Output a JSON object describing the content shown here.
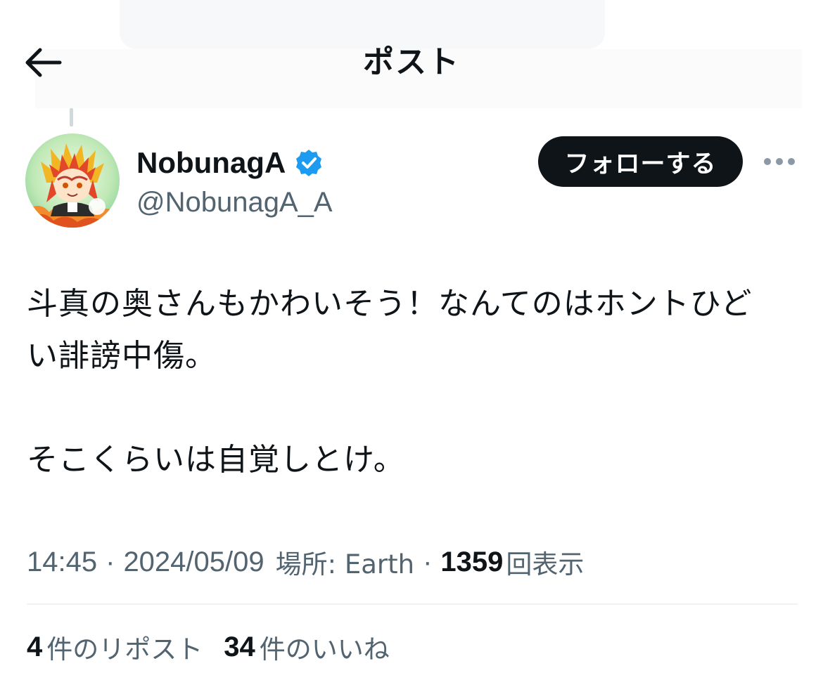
{
  "header": {
    "title": "ポスト",
    "back_icon": "arrow-left-icon"
  },
  "author": {
    "name": "NobunagA",
    "handle": "@NobunagA_A",
    "verified": true,
    "verified_color": "#1d9bf0",
    "avatar_icon": "anime-character-avatar"
  },
  "actions": {
    "follow_label": "フォローする",
    "more_icon": "more-horizontal-icon"
  },
  "tweet": {
    "text": "斗真の奥さんもかわいそう！なんてのはホントひど\nい誹謗中傷。\n\nそこくらいは自覚しとけ。"
  },
  "meta": {
    "time": "14:45",
    "separator": "·",
    "date": "2024/05/09",
    "location_label": "場所: Earth",
    "views_count": "1359",
    "views_label": "回表示"
  },
  "stats": {
    "reposts_count": "4",
    "reposts_label": "件のリポスト",
    "likes_count": "34",
    "likes_label": "件のいいね"
  },
  "colors": {
    "text_primary": "#0f1419",
    "text_secondary": "#536471",
    "button_bg": "#0f1419",
    "divider": "#eff3f4"
  }
}
